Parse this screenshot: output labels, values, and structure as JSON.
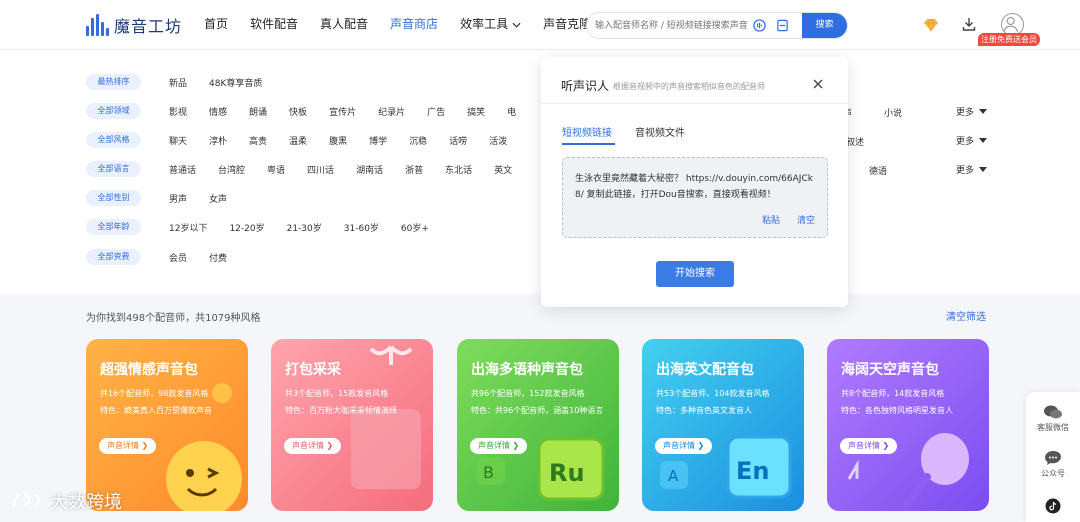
{
  "app": {
    "logo_text": "魔音工坊"
  },
  "nav": {
    "items": [
      "首页",
      "软件配音",
      "真人配音",
      "声音商店",
      "效率工具",
      "声音克隆"
    ],
    "active_index": 3,
    "search_placeholder": "输入配音师名称 / 短视频链接搜索声音",
    "search_button": "搜索",
    "register_badge": "注册免费送会员"
  },
  "filters": {
    "rows": [
      {
        "tag": "最热排序",
        "options": [
          "新品",
          "48K尊享音质"
        ]
      },
      {
        "tag": "全部领域",
        "options": [
          "影视",
          "情感",
          "朗诵",
          "快板",
          "宣传片",
          "纪录片",
          "广告",
          "搞笑",
          "电"
        ],
        "right_options": [
          "声",
          "小说"
        ],
        "more": "更多"
      },
      {
        "tag": "全部风格",
        "options": [
          "聊天",
          "淳朴",
          "高贵",
          "温柔",
          "腹黑",
          "博学",
          "沉稳",
          "话唠",
          "活泼"
        ],
        "right_options": [
          "叙述"
        ],
        "more": "更多"
      },
      {
        "tag": "全部语言",
        "options": [
          "普通话",
          "台湾腔",
          "粤语",
          "四川话",
          "湖南话",
          "浙普",
          "东北话",
          "英文"
        ],
        "right_options": [
          "德语"
        ],
        "more": "更多"
      },
      {
        "tag": "全部性别",
        "options": [
          "男声",
          "女声"
        ]
      },
      {
        "tag": "全部年龄",
        "options": [
          "12岁以下",
          "12-20岁",
          "21-30岁",
          "31-60岁",
          "60岁+"
        ]
      },
      {
        "tag": "全部资费",
        "options": [
          "会员",
          "付费"
        ]
      }
    ]
  },
  "results": {
    "count_text": "为你找到498个配音师，共1079种风格",
    "clear_label": "清空筛选"
  },
  "cards": [
    {
      "title": "超强情感声音包",
      "line1": "共16个配音师，98款发音风格",
      "line2": "特色：媲美真人百万赞爆款声音",
      "button": "声音详情 ❯",
      "colors": [
        "#ffb347",
        "#ff8a2a"
      ],
      "btn_color": "#f07a1f"
    },
    {
      "title": "打包采采",
      "line1": "共3个配音师，15款发音风格",
      "line2": "特色：百万粉大咖采采倾情演绎",
      "button": "声音详情 ❯",
      "colors": [
        "#ffa4ac",
        "#f56d7d"
      ],
      "btn_color": "#e95a6c"
    },
    {
      "title": "出海多语种声音包",
      "line1": "共96个配音师，152款发音风格",
      "line2": "特色：共96个配音师，涵盖10种语言",
      "button": "声音详情 ❯",
      "colors": [
        "#7fdc5d",
        "#3fb43a"
      ],
      "btn_color": "#39a637"
    },
    {
      "title": "出海英文配音包",
      "line1": "共53个配音师，104款发音风格",
      "line2": "特色：多种音色英文发音人",
      "button": "声音详情 ❯",
      "colors": [
        "#44d0f0",
        "#1a8fe0"
      ],
      "btn_color": "#1a86d8"
    },
    {
      "title": "海阔天空声音包",
      "line1": "共8个配音师，14款发音风格",
      "line2": "特色：各色独特风格明星发音人",
      "button": "声音详情 ❯",
      "colors": [
        "#b07bff",
        "#7b4df0"
      ],
      "btn_color": "#7a49e6"
    }
  ],
  "popup": {
    "title": "听声识人",
    "subtitle": "根据音视频中的声音搜索相似音色的配音师",
    "tabs": [
      "短视频链接",
      "音视频文件"
    ],
    "active_tab": 0,
    "text": "生泳衣里竟然藏着大秘密？ https://v.douyin.com/66AJCk8/ 复制此链接，打开Dou音搜索，直接观看视频！",
    "paste": "粘贴",
    "clear": "清空",
    "button": "开始搜索"
  },
  "sidebar": {
    "items": [
      "客服微信",
      "公众号"
    ]
  },
  "watermark": {
    "text": "大数跨境"
  },
  "colors": {
    "accent": "#2f6de1",
    "badge": "#f04a3e"
  }
}
